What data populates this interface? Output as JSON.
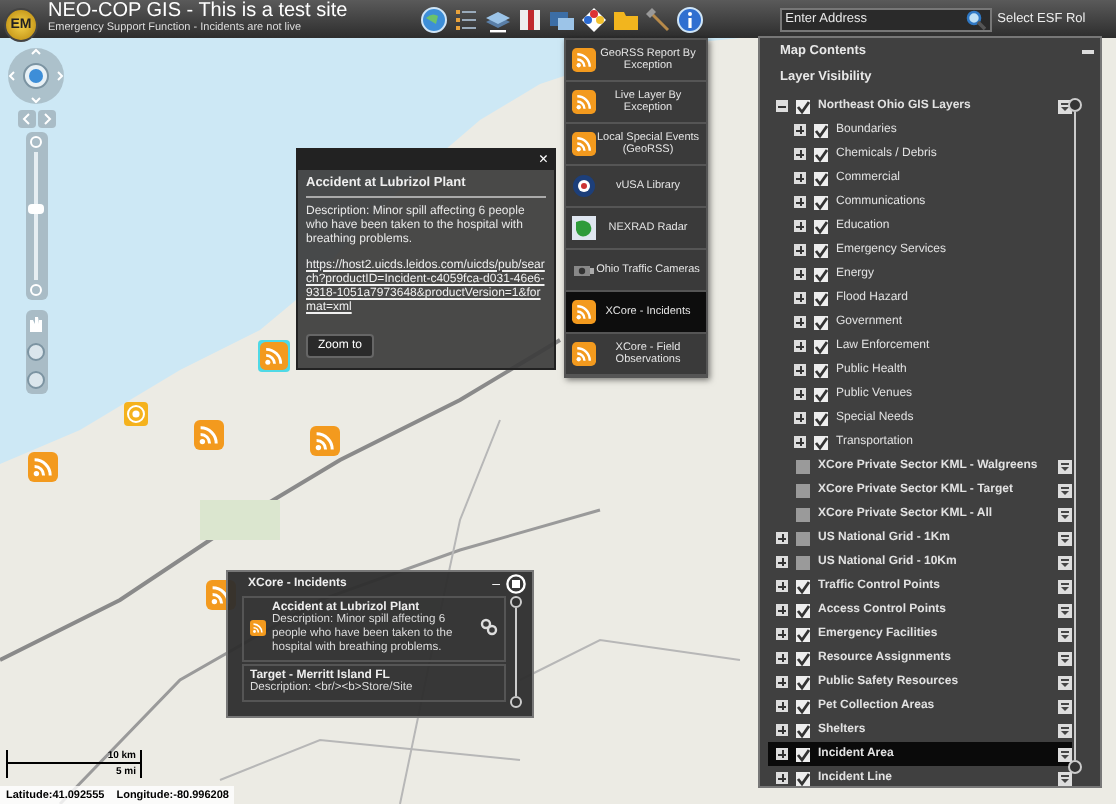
{
  "header": {
    "title": "NEO-COP GIS - This is a test site",
    "subtitle": "Emergency Support Function - Incidents are not live",
    "logo": "EM"
  },
  "address_search": {
    "placeholder": "Enter Address"
  },
  "role_label": "Select ESF Rol",
  "feed_menu": [
    {
      "label": "GeoRSS Report By Exception",
      "kind": "rss",
      "selected": false
    },
    {
      "label": "Live Layer By Exception",
      "kind": "rss",
      "selected": false
    },
    {
      "label": "Local Special Events (GeoRSS)",
      "kind": "rss",
      "selected": false
    },
    {
      "label": "vUSA Library",
      "kind": "seal",
      "selected": false
    },
    {
      "label": "NEXRAD Radar",
      "kind": "radar",
      "selected": false
    },
    {
      "label": "Ohio Traffic Cameras",
      "kind": "camera",
      "selected": false
    },
    {
      "label": "XCore - Incidents",
      "kind": "rss",
      "selected": true
    },
    {
      "label": "XCore - Field Observations",
      "kind": "rss",
      "selected": false
    }
  ],
  "map_contents": {
    "title": "Map Contents",
    "subtitle": "Layer Visibility",
    "layers": [
      {
        "label": "Northeast Ohio GIS Layers",
        "kind": "group",
        "expanded": true,
        "checked": true,
        "selected": false,
        "children": [
          {
            "label": "Boundaries",
            "checked": true
          },
          {
            "label": "Chemicals / Debris",
            "checked": true
          },
          {
            "label": "Commercial",
            "checked": true
          },
          {
            "label": "Communications",
            "checked": true
          },
          {
            "label": "Education",
            "checked": true
          },
          {
            "label": "Emergency Services",
            "checked": true
          },
          {
            "label": "Energy",
            "checked": true
          },
          {
            "label": "Flood Hazard",
            "checked": true
          },
          {
            "label": "Government",
            "checked": true
          },
          {
            "label": "Law Enforcement",
            "checked": true
          },
          {
            "label": "Public Health",
            "checked": true
          },
          {
            "label": "Public Venues",
            "checked": true
          },
          {
            "label": "Special Needs",
            "checked": true
          },
          {
            "label": "Transportation",
            "checked": true
          }
        ]
      },
      {
        "label": "XCore Private Sector KML - Walgreens",
        "kind": "plain",
        "checked": false,
        "selected": false
      },
      {
        "label": "XCore Private Sector KML - Target",
        "kind": "plain",
        "checked": false,
        "selected": false
      },
      {
        "label": "XCore Private Sector KML - All",
        "kind": "plain",
        "checked": false,
        "selected": false
      },
      {
        "label": "US National Grid - 1Km",
        "kind": "group",
        "expanded": false,
        "checked": false,
        "selected": false
      },
      {
        "label": "US National Grid - 10Km",
        "kind": "group",
        "expanded": false,
        "checked": false,
        "selected": false
      },
      {
        "label": "Traffic Control Points",
        "kind": "group",
        "expanded": false,
        "checked": true,
        "selected": false
      },
      {
        "label": "Access Control Points",
        "kind": "group",
        "expanded": false,
        "checked": true,
        "selected": false
      },
      {
        "label": "Emergency Facilities",
        "kind": "group",
        "expanded": false,
        "checked": true,
        "selected": false
      },
      {
        "label": "Resource Assignments",
        "kind": "group",
        "expanded": false,
        "checked": true,
        "selected": false
      },
      {
        "label": "Public Safety Resources",
        "kind": "group",
        "expanded": false,
        "checked": true,
        "selected": false
      },
      {
        "label": "Pet Collection Areas",
        "kind": "group",
        "expanded": false,
        "checked": true,
        "selected": false
      },
      {
        "label": "Shelters",
        "kind": "group",
        "expanded": false,
        "checked": true,
        "selected": false
      },
      {
        "label": "Incident Area",
        "kind": "group",
        "expanded": false,
        "checked": true,
        "selected": true
      },
      {
        "label": "Incident Line",
        "kind": "group",
        "expanded": false,
        "checked": true,
        "selected": false
      }
    ]
  },
  "zoom_slider": {
    "level": 0.55
  },
  "info_popup": {
    "close": "×",
    "title": "Accident at Lubrizol Plant",
    "description": "Description: Minor spill affecting 6 people who have been taken to the hospital with breathing problems.",
    "link": "https://host2.uicds.leidos.com/uicds/pub/search?productID=Incident-c4059fca-d031-46e6-9318-1051a7973648&productVersion=1&format=xml",
    "button": "Zoom to"
  },
  "incidents_popup": {
    "title": "XCore - Incidents",
    "minimize": "–",
    "entries": [
      {
        "title": "Accident at Lubrizol Plant",
        "description": "Description: Minor spill affecting 6 people who have been taken to the hospital with breathing problems."
      },
      {
        "title": "Target - Merritt Island FL",
        "description": "Description: <br/><b>Store/Site"
      }
    ]
  },
  "scale": {
    "metric": "10 km",
    "imperial": "5 mi"
  },
  "status_bar": {
    "latitude": "Latitude:41.092555",
    "longitude": "Longitude:-80.996208"
  }
}
